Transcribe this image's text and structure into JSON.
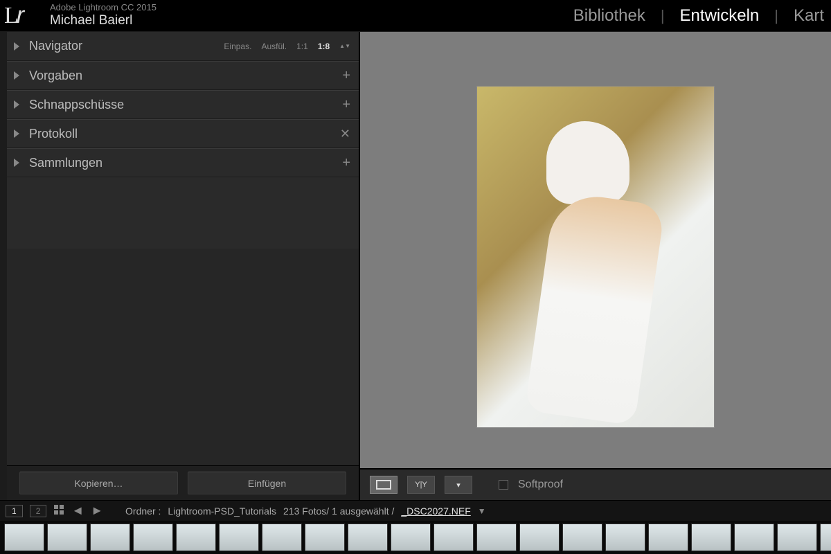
{
  "header": {
    "app_title": "Adobe Lightroom CC 2015",
    "user_name": "Michael Baierl",
    "logo": "Lr",
    "modules": {
      "library": "Bibliothek",
      "develop": "Entwickeln",
      "map_partial": "Kart"
    }
  },
  "left_panel": {
    "navigator": {
      "label": "Navigator",
      "zoom": {
        "fit": "Einpas.",
        "fill": "Ausfül.",
        "one_to_one": "1:1",
        "custom": "1:8"
      }
    },
    "panels": {
      "presets": "Vorgaben",
      "snapshots": "Schnappschüsse",
      "history": "Protokoll",
      "collections": "Sammlungen"
    },
    "buttons": {
      "copy": "Kopieren…",
      "paste": "Einfügen"
    }
  },
  "toolbar": {
    "softproof": "Softproof"
  },
  "filmstrip": {
    "view1": "1",
    "view2": "2",
    "folder_label": "Ordner :",
    "folder_name": "Lightroom-PSD_Tutorials",
    "count_text": "213 Fotos/ 1 ausgewählt /",
    "filename": "_DSC2027.NEF"
  }
}
